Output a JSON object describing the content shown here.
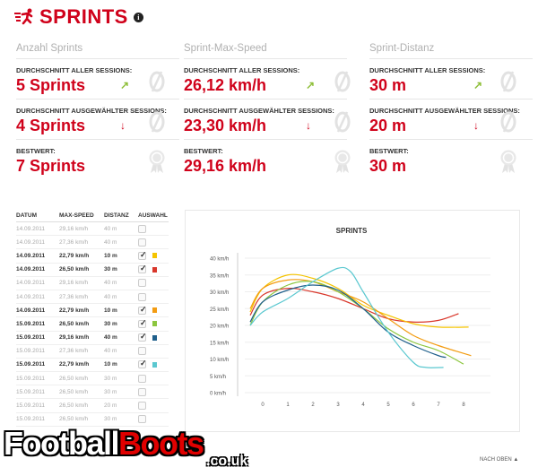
{
  "header": {
    "title": "SPRINTS",
    "info": "i"
  },
  "stats": [
    {
      "heading": "Anzahl Sprints",
      "avg_all": {
        "label": "DURCHSCHNITT ALLER SESSIONS:",
        "value": "5 Sprints",
        "trend": "↗",
        "dir": "up"
      },
      "avg_sel": {
        "label": "DURCHSCHNITT AUSGEWÄHLTER SESSIONS:",
        "value": "4 Sprints",
        "trend": "↓",
        "dir": "down"
      },
      "best": {
        "label": "BESTWERT:",
        "value": "7 Sprints"
      }
    },
    {
      "heading": "Sprint-Max-Speed",
      "avg_all": {
        "label": "DURCHSCHNITT ALLER SESSIONS:",
        "value": "26,12 km/h",
        "trend": "↗",
        "dir": "up"
      },
      "avg_sel": {
        "label": "DURCHSCHNITT AUSGEWÄHLTER SESSIONS:",
        "value": "23,30 km/h",
        "trend": "↓",
        "dir": "down"
      },
      "best": {
        "label": "BESTWERT:",
        "value": "29,16 km/h"
      }
    },
    {
      "heading": "Sprint-Distanz",
      "avg_all": {
        "label": "DURCHSCHNITT ALLER SESSIONS:",
        "value": "30 m",
        "trend": "↗",
        "dir": "up"
      },
      "avg_sel": {
        "label": "DURCHSCHNITT AUSGEWÄHLTER SESSIONS:",
        "value": "20 m",
        "trend": "↓",
        "dir": "down"
      },
      "best": {
        "label": "BESTWERT:",
        "value": "30 m"
      }
    }
  ],
  "table": {
    "headers": {
      "date": "DATUM",
      "speed": "MAX-SPEED",
      "distance": "DISTANZ",
      "select": "AUSWAHL"
    },
    "rows": [
      {
        "date": "14.09.2011",
        "speed": "29,16 km/h",
        "distance": "40 m",
        "checked": false,
        "color": ""
      },
      {
        "date": "14.09.2011",
        "speed": "27,36 km/h",
        "distance": "40 m",
        "checked": false,
        "color": ""
      },
      {
        "date": "14.09.2011",
        "speed": "22,79 km/h",
        "distance": "10 m",
        "checked": true,
        "color": "#f5c400"
      },
      {
        "date": "14.09.2011",
        "speed": "26,50 km/h",
        "distance": "30 m",
        "checked": true,
        "color": "#d9372b"
      },
      {
        "date": "14.09.2011",
        "speed": "29,16 km/h",
        "distance": "40 m",
        "checked": false,
        "color": ""
      },
      {
        "date": "14.09.2011",
        "speed": "27,36 km/h",
        "distance": "40 m",
        "checked": false,
        "color": ""
      },
      {
        "date": "14.09.2011",
        "speed": "22,79 km/h",
        "distance": "10 m",
        "checked": true,
        "color": "#f39c12"
      },
      {
        "date": "15.09.2011",
        "speed": "26,50 km/h",
        "distance": "30 m",
        "checked": true,
        "color": "#8cc63f"
      },
      {
        "date": "15.09.2011",
        "speed": "29,16 km/h",
        "distance": "40 m",
        "checked": true,
        "color": "#1f5f8b"
      },
      {
        "date": "15.09.2011",
        "speed": "27,36 km/h",
        "distance": "40 m",
        "checked": false,
        "color": ""
      },
      {
        "date": "15.09.2011",
        "speed": "22,79 km/h",
        "distance": "10 m",
        "checked": true,
        "color": "#5bc8d0"
      },
      {
        "date": "15.09.2011",
        "speed": "26,50 km/h",
        "distance": "30 m",
        "checked": false,
        "color": ""
      },
      {
        "date": "15.09.2011",
        "speed": "26,50 km/h",
        "distance": "30 m",
        "checked": false,
        "color": ""
      },
      {
        "date": "15.09.2011",
        "speed": "26,50 km/h",
        "distance": "20 m",
        "checked": false,
        "color": ""
      },
      {
        "date": "15.09.2011",
        "speed": "26,50 km/h",
        "distance": "30 m",
        "checked": false,
        "color": ""
      }
    ]
  },
  "chart_data": {
    "type": "line",
    "title": "SPRINTS",
    "xlabel": "",
    "ylabel": "",
    "xlim": [
      0,
      8
    ],
    "ylim": [
      0,
      40
    ],
    "x_ticks": [
      "0",
      "1",
      "2",
      "3",
      "4",
      "5",
      "6",
      "7",
      "8"
    ],
    "y_ticks": [
      "0 km/h",
      "5 km/h",
      "10 km/h",
      "15 km/h",
      "20 km/h",
      "25 km/h",
      "30 km/h",
      "35 km/h",
      "40 km/h"
    ],
    "grid": true,
    "series": [
      {
        "color": "#d9372b",
        "points": [
          [
            -0.5,
            23
          ],
          [
            0,
            29
          ],
          [
            1,
            31
          ],
          [
            2,
            30
          ],
          [
            3,
            28
          ],
          [
            4,
            25
          ],
          [
            5,
            22
          ],
          [
            6,
            21
          ],
          [
            7,
            21.5
          ],
          [
            7.8,
            23.5
          ]
        ]
      },
      {
        "color": "#f5c400",
        "points": [
          [
            -0.5,
            24
          ],
          [
            0,
            31
          ],
          [
            1,
            35
          ],
          [
            2,
            34
          ],
          [
            3,
            31
          ],
          [
            4,
            26
          ],
          [
            5,
            23
          ],
          [
            6,
            20.5
          ],
          [
            7,
            19.5
          ],
          [
            8.2,
            19.5
          ]
        ]
      },
      {
        "color": "#f39c12",
        "points": [
          [
            -0.5,
            25
          ],
          [
            0,
            31
          ],
          [
            1,
            33.5
          ],
          [
            2,
            33
          ],
          [
            3,
            30
          ],
          [
            4,
            27
          ],
          [
            5,
            22
          ],
          [
            6,
            17
          ],
          [
            7,
            14
          ],
          [
            8.3,
            11
          ]
        ]
      },
      {
        "color": "#8cc63f",
        "points": [
          [
            -0.5,
            20
          ],
          [
            0,
            27
          ],
          [
            1,
            32
          ],
          [
            2,
            33
          ],
          [
            3,
            30
          ],
          [
            4,
            25
          ],
          [
            5,
            19
          ],
          [
            6,
            15
          ],
          [
            7,
            12.5
          ],
          [
            8,
            8.5
          ]
        ]
      },
      {
        "color": "#1f5f8b",
        "points": [
          [
            -0.5,
            21
          ],
          [
            0,
            27
          ],
          [
            1,
            30.5
          ],
          [
            2,
            32
          ],
          [
            3,
            30.5
          ],
          [
            4,
            25
          ],
          [
            5,
            18
          ],
          [
            6,
            14
          ],
          [
            7,
            11
          ],
          [
            7.3,
            10.5
          ]
        ]
      },
      {
        "color": "#5bc8d0",
        "points": [
          [
            -0.5,
            20
          ],
          [
            0,
            24
          ],
          [
            1,
            28
          ],
          [
            2,
            33
          ],
          [
            3,
            37
          ],
          [
            3.5,
            36
          ],
          [
            4,
            30
          ],
          [
            5,
            18
          ],
          [
            6,
            9
          ],
          [
            6.5,
            7.5
          ],
          [
            7.2,
            7.5
          ]
        ]
      }
    ]
  },
  "logo": {
    "part1": "Football",
    "part2": "Boots",
    "sub": ".co.uk"
  },
  "footer": {
    "back_to_top": "NACH OBEN  ▲"
  },
  "colors": {
    "accent": "#d0021b",
    "trend_up": "#8fbf3a"
  },
  "icons": {
    "header": "sprinter-icon",
    "info": "info-icon",
    "zero": "zero-icon",
    "best": "medal-icon"
  }
}
